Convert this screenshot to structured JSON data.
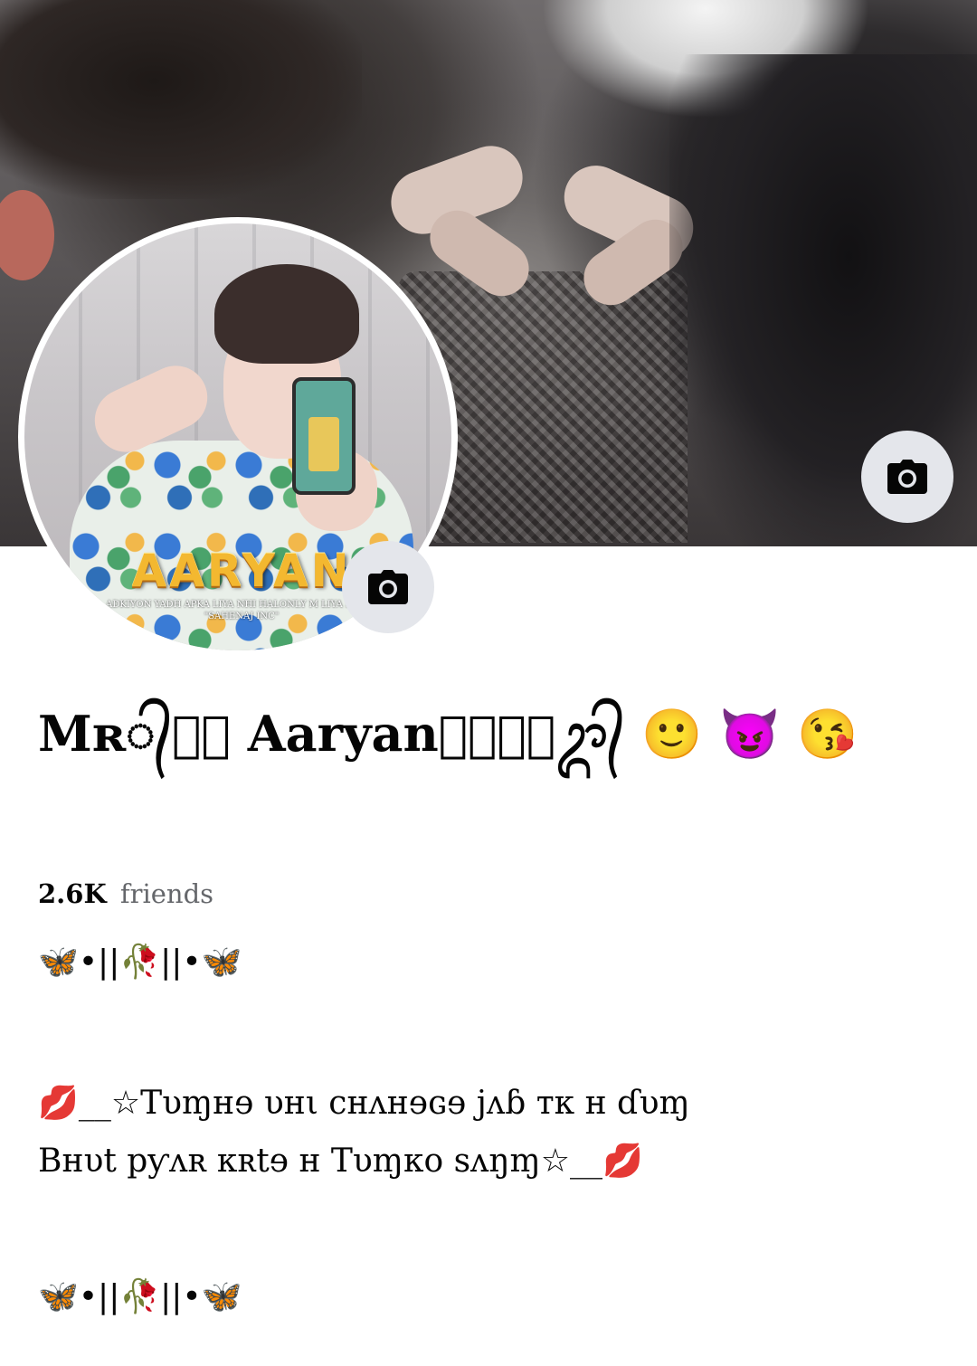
{
  "profile": {
    "name": "Mʀ᭄꙰⃟ Aaryan꙰⃟‿⃝ᬊ᭄ 🙂 😈 😘",
    "friends_count": "2.6K",
    "friends_label": "friends",
    "avatar_name_art": "AARYAN",
    "avatar_tagline": "ADKIYON YADH APKA LIYA NHI HALONLY M LIYA HALYA \"SAHENAJ INC\""
  },
  "bio": {
    "line1": "🦋•||🥀||•🦋",
    "line2": "💋__☆Tυɱнɘ υнι cнʌнɘɢɘ jʌɓ ᴛκ н ɗυɱ",
    "line3": "Bнυt pƴʌʀ κʀtɘ н Tυɱκo sʌŋɱ☆__💋",
    "line4": "🦋•||🥀||•🦋"
  },
  "icons": {
    "cover_camera": "camera-icon",
    "avatar_camera": "camera-icon"
  },
  "colors": {
    "camera_button_bg": "#e4e6eb",
    "secondary_text": "#65676b",
    "primary_text": "#050505"
  }
}
